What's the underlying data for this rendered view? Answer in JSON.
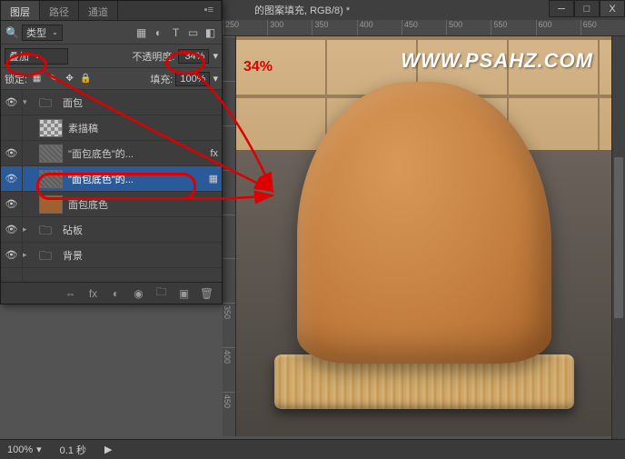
{
  "window": {
    "doc_title": "的图案填充, RGB/8) *",
    "min": "─",
    "max": "□",
    "close": "X"
  },
  "panel": {
    "tabs": {
      "layers": "图层",
      "paths": "路径",
      "channels": "通道",
      "menu": "▪≡"
    },
    "filter": {
      "kind_icon": "🔍",
      "kind": "类型",
      "chev": "⌄"
    },
    "icons": {
      "img": "▦",
      "adj": "◐",
      "txt": "T",
      "shape": "▭",
      "fx": "◧"
    },
    "blend": {
      "mode": "叠加",
      "chev": "⌄",
      "opacity_label": "不透明度:",
      "opacity": "34%",
      "chev2": "▾"
    },
    "lock": {
      "label": "锁定:",
      "pix": "▦",
      "brush": "✎",
      "move": "✥",
      "all": "🔒",
      "fill_label": "填充:",
      "fill": "100%",
      "chev": "▾"
    },
    "layers": [
      {
        "eye": "👁",
        "type": "folder",
        "name": "面包",
        "expand": "▾"
      },
      {
        "eye": "",
        "indent": 1,
        "type": "checker",
        "name": "素描稿"
      },
      {
        "eye": "👁",
        "indent": 1,
        "type": "noise",
        "name": "\"面包底色\"的...",
        "link": "⬚",
        "selected": false,
        "fx": "fx"
      },
      {
        "eye": "👁",
        "indent": 1,
        "type": "noise",
        "name": "\"面包底色\"的...",
        "link": "⬚",
        "selected": true,
        "fx": "▦"
      },
      {
        "eye": "👁",
        "indent": 1,
        "type": "brown",
        "name": "面包底色"
      },
      {
        "eye": "👁",
        "type": "folder",
        "name": "砧板",
        "expand": "▸"
      },
      {
        "eye": "👁",
        "type": "folder",
        "name": "背景",
        "expand": "▸"
      },
      {
        "eye": "",
        "type": "blank",
        "name": ""
      }
    ],
    "footer": {
      "link": "⇔",
      "fx": "fx",
      "mask": "◐",
      "adj": "◉",
      "group": "🗀",
      "new": "▣",
      "trash": "🗑"
    }
  },
  "ruler_h": [
    "250",
    "300",
    "350",
    "400",
    "450",
    "500",
    "550",
    "600",
    "650"
  ],
  "ruler_v": [
    "",
    "",
    "",
    "",
    "",
    "",
    "350",
    "400",
    "450"
  ],
  "status": {
    "zoom": "100%",
    "chev": "▾",
    "time": "0.1 秒",
    "play": "▶"
  },
  "annotations": {
    "percent": "34%",
    "watermark": "WWW.PSAHZ.COM"
  }
}
